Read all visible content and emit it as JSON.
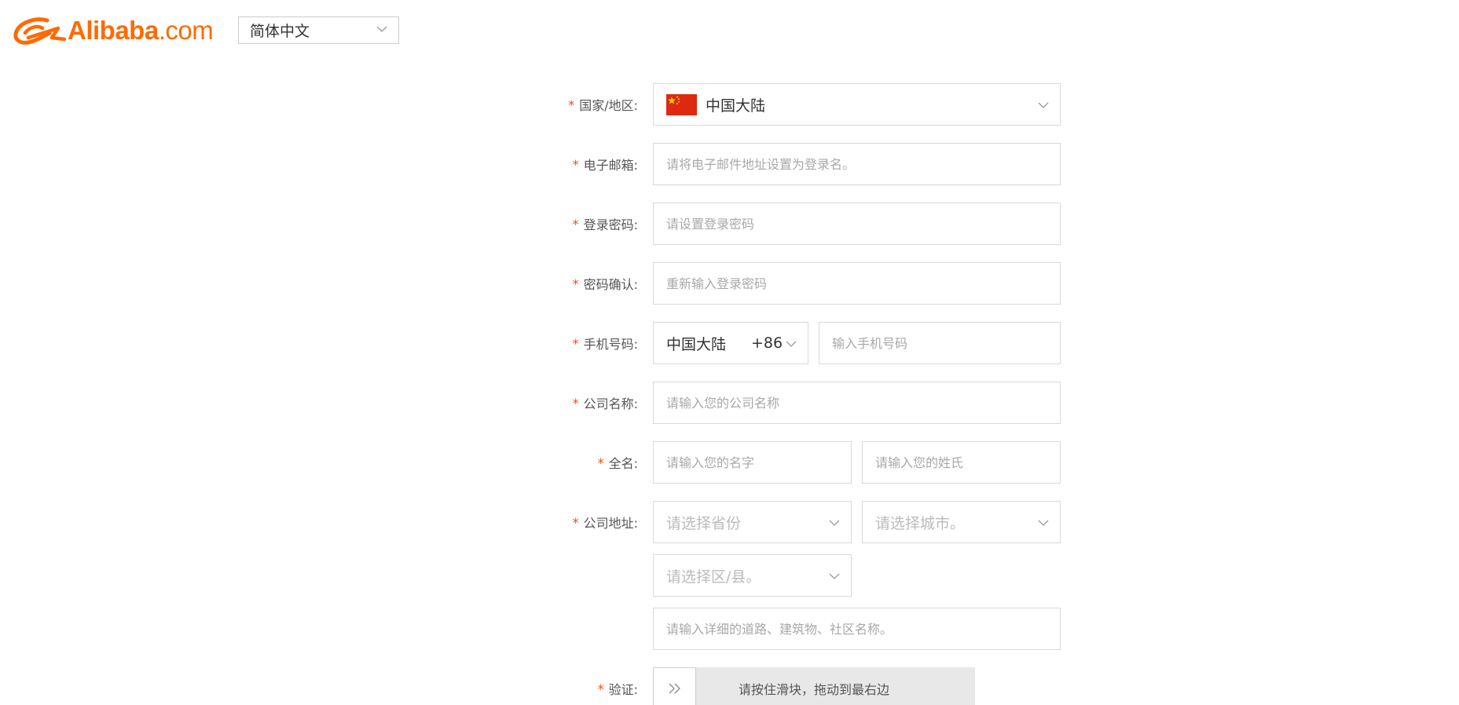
{
  "header": {
    "logo_text": "Alibaba",
    "logo_suffix": ".com",
    "language": "简体中文"
  },
  "form": {
    "required_mark": "*",
    "country": {
      "label": "国家/地区:",
      "value": "中国大陆"
    },
    "email": {
      "label": "电子邮箱:",
      "placeholder": "请将电子邮件地址设置为登录名。"
    },
    "password": {
      "label": "登录密码:",
      "placeholder": "请设置登录密码"
    },
    "password_confirm": {
      "label": "密码确认:",
      "placeholder": "重新输入登录密码"
    },
    "phone": {
      "label": "手机号码:",
      "region": "中国大陆",
      "code": "+86",
      "placeholder": "输入手机号码"
    },
    "company_name": {
      "label": "公司名称:",
      "placeholder": "请输入您的公司名称"
    },
    "full_name": {
      "label": "全名:",
      "first_placeholder": "请输入您的名字",
      "last_placeholder": "请输入您的姓氏"
    },
    "address": {
      "label": "公司地址:",
      "province_placeholder": "请选择省份",
      "city_placeholder": "请选择城市。",
      "district_placeholder": "请选择区/县。",
      "street_placeholder": "请输入详细的道路、建筑物、社区名称。"
    },
    "verify": {
      "label": "验证:",
      "slider_text": "请按住滑块，拖动到最右边"
    }
  },
  "colors": {
    "brand": "#ff6a00",
    "required": "#ff4a00",
    "border": "#d9d9d9",
    "placeholder": "#a8a8a8",
    "slider_track": "#e8e8e8"
  }
}
